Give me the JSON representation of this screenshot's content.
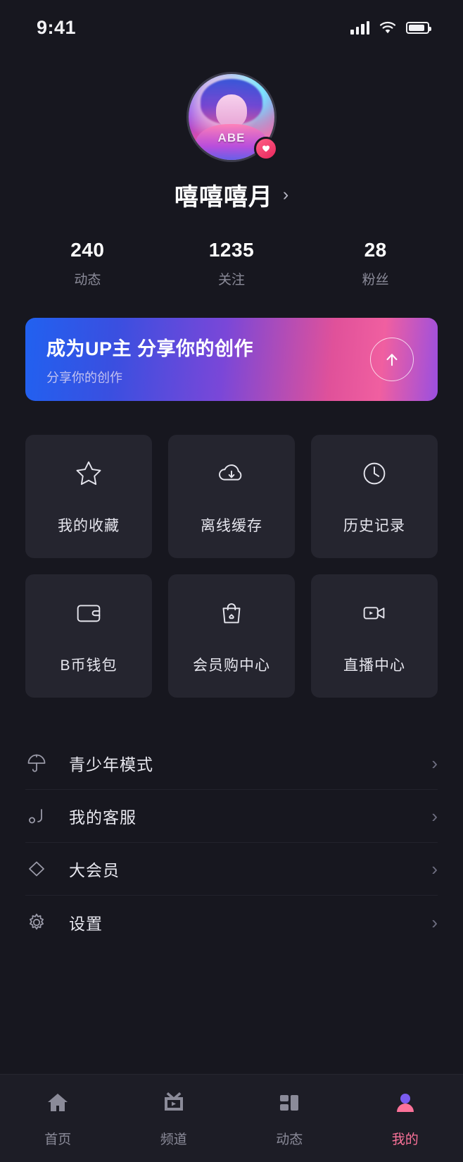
{
  "status_bar": {
    "time": "9:41",
    "signal_icon": "cellular-signal-icon",
    "wifi_icon": "wifi-icon",
    "battery_icon": "battery-icon"
  },
  "profile": {
    "avatar_icon": "user-avatar",
    "avatar_overlay_text": "ABE",
    "verified_badge_icon": "heart-badge-icon",
    "username": "嘻嘻嘻月",
    "chevron": "›"
  },
  "stats": [
    {
      "value": "240",
      "label": "动态"
    },
    {
      "value": "1235",
      "label": "关注"
    },
    {
      "value": "28",
      "label": "粉丝"
    }
  ],
  "banner": {
    "title": "成为UP主 分享你的创作",
    "subtitle": "分享你的创作",
    "button_icon": "upload-arrow-icon"
  },
  "grid": [
    {
      "label": "我的收藏",
      "icon": "star-icon"
    },
    {
      "label": "离线缓存",
      "icon": "cloud-download-icon"
    },
    {
      "label": "历史记录",
      "icon": "clock-icon"
    },
    {
      "label": "B币钱包",
      "icon": "wallet-icon"
    },
    {
      "label": "会员购中心",
      "icon": "shopping-bag-icon"
    },
    {
      "label": "直播中心",
      "icon": "video-camera-icon"
    }
  ],
  "list": [
    {
      "label": "青少年模式",
      "icon": "umbrella-icon",
      "chevron": "›"
    },
    {
      "label": "我的客服",
      "icon": "headset-icon",
      "chevron": "›"
    },
    {
      "label": "大会员",
      "icon": "diamond-icon",
      "chevron": "›"
    },
    {
      "label": "设置",
      "icon": "gear-icon",
      "chevron": "›"
    }
  ],
  "tabbar": [
    {
      "label": "首页",
      "icon": "home-icon",
      "active": false
    },
    {
      "label": "频道",
      "icon": "tv-icon",
      "active": false
    },
    {
      "label": "动态",
      "icon": "layout-icon",
      "active": false
    },
    {
      "label": "我的",
      "icon": "person-icon",
      "active": true
    }
  ],
  "colors": {
    "background": "#17171f",
    "card": "#25252f",
    "accent": "#fb7299",
    "tabbar": "#1d1d26",
    "text_primary": "#ffffff",
    "text_secondary": "#8b8b99"
  }
}
